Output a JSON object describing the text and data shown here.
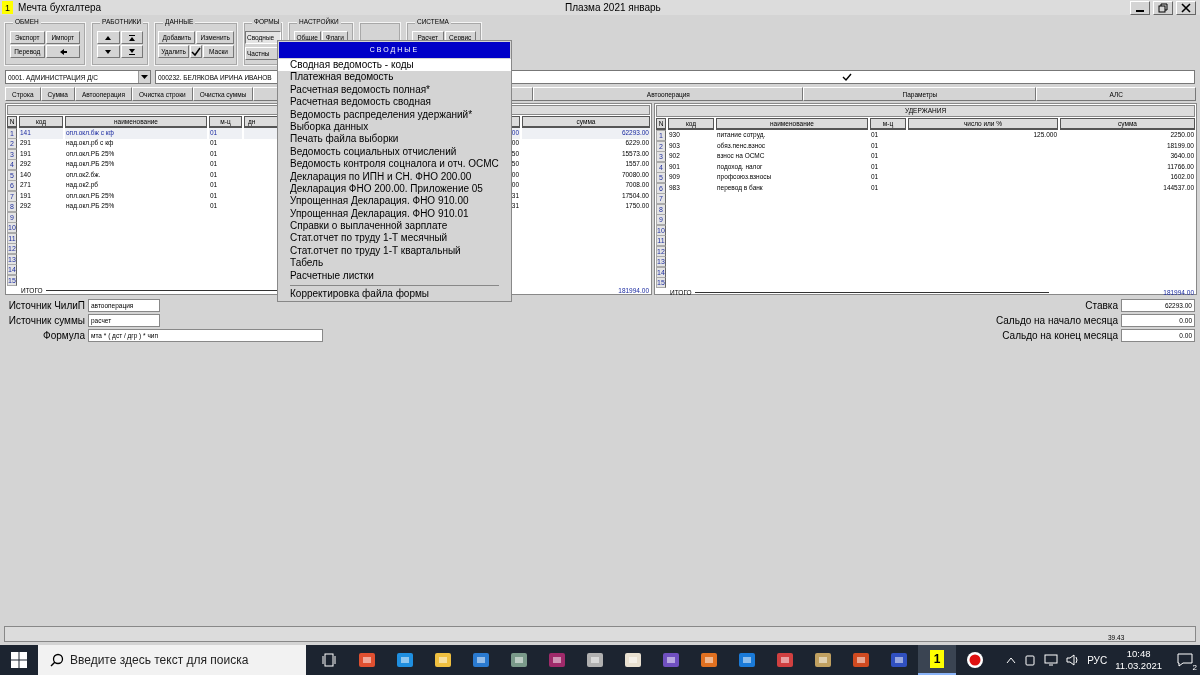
{
  "window": {
    "app_badge": "1",
    "title": "Мечта бухгалтера",
    "center_title": "Плазма 2021 январь"
  },
  "toolbar": {
    "groups": [
      {
        "title": "ОБМЕН",
        "kind": "text",
        "buttons": [
          {
            "label": "Экспорт"
          },
          {
            "label": "Импорт"
          },
          {
            "label": "Перевод"
          },
          {
            "kind": "icon"
          }
        ]
      },
      {
        "title": "РАБОТНИКИ",
        "kind": "icons",
        "buttons": [
          {
            "kind": "icon"
          },
          {
            "kind": "icon"
          },
          {
            "kind": "icon"
          },
          {
            "kind": "icon"
          }
        ]
      },
      {
        "title": "ДАННЫЕ",
        "kind": "text",
        "buttons": [
          {
            "label": "Добавить"
          },
          {
            "label": "Изменить"
          },
          {
            "label": "Удалить"
          },
          {
            "kind": "icon"
          },
          {
            "label": "Маски"
          }
        ]
      },
      {
        "title": "ФОРМЫ",
        "kind": "text",
        "buttons": [
          {
            "label": "Сводные",
            "pressed": true
          },
          {
            "label": "Частны",
            "pressed": false
          }
        ]
      },
      {
        "title": "НАСТРОЙКИ",
        "kind": "text",
        "buttons": [
          {
            "label": "Общие"
          },
          {
            "label": "Флаги"
          }
        ]
      },
      {
        "kind": "empty"
      },
      {
        "title": "СИСТЕМА",
        "kind": "text",
        "buttons": [
          {
            "label": "Расчет"
          },
          {
            "label": "Сервис"
          }
        ]
      }
    ]
  },
  "selectors": {
    "department": "0001. АДМИНИСТРАЦИЯ Д/С",
    "employee": "000232. БЕЛЯКОВА ИРИНА ИВАНОВ",
    "confirmed": true
  },
  "action_buttons": [
    "Строка",
    "Сумма",
    "Автооперация",
    "Очистка строки",
    "Очистка суммы"
  ],
  "right_buttons": [
    "Автооперация",
    "Параметры",
    "АЛС"
  ],
  "accruals": {
    "columns": [
      "N",
      "код",
      "наименование",
      "м-ц",
      "дн",
      "сумма"
    ],
    "rows": [
      {
        "n": "1",
        "code": "141",
        "name": "опл.окл.бж с кф",
        "month": "01",
        "column_5": "00",
        "sum": "62293.00",
        "selected": true
      },
      {
        "n": "2",
        "code": "291",
        "name": "над.окл.рб с кф",
        "month": "01",
        "column_5": "00",
        "sum": "6229.00",
        "selected": false
      },
      {
        "n": "3",
        "code": "191",
        "name": "опл.окл.РБ 25%",
        "month": "01",
        "column_5": "50",
        "sum": "15573.00",
        "selected": false
      },
      {
        "n": "4",
        "code": "292",
        "name": "над.окл.РБ 25%",
        "month": "01",
        "column_5": "50",
        "sum": "1557.00",
        "selected": false
      },
      {
        "n": "5",
        "code": "140",
        "name": "опл.ок2.бж.",
        "month": "01",
        "column_5": "00",
        "sum": "70080.00",
        "selected": false
      },
      {
        "n": "6",
        "code": "271",
        "name": "над.ок2.рб",
        "month": "01",
        "column_5": "00",
        "sum": "7008.00",
        "selected": false
      },
      {
        "n": "7",
        "code": "191",
        "name": "опл.окл.РБ 25%",
        "month": "01",
        "column_5": "31",
        "sum": "17504.00",
        "selected": false
      },
      {
        "n": "8",
        "code": "292",
        "name": "над.окл.РБ 25%",
        "month": "01",
        "column_5": "31",
        "sum": "1750.00",
        "selected": false
      },
      {
        "n": "9"
      },
      {
        "n": "10"
      },
      {
        "n": "11"
      },
      {
        "n": "12"
      },
      {
        "n": "13"
      },
      {
        "n": "14"
      },
      {
        "n": "15"
      }
    ],
    "total_label": "ИТОГО",
    "total": "181994.00"
  },
  "deductions": {
    "title": "УДЕРЖАНИЯ",
    "columns": [
      "N",
      "код",
      "наименование",
      "м-ц",
      "число или %",
      "сумма"
    ],
    "rows": [
      {
        "n": "1",
        "code": "930",
        "name": "питание сотруд.",
        "month": "01",
        "value": "125.000",
        "sum": "2250.00"
      },
      {
        "n": "2",
        "code": "903",
        "name": "обяз.пенс.взнос",
        "month": "01",
        "sum": "18199.00"
      },
      {
        "n": "3",
        "code": "902",
        "name": "взнос на ОСМС",
        "month": "01",
        "sum": "3640.00"
      },
      {
        "n": "4",
        "code": "901",
        "name": "подоход. налог",
        "month": "01",
        "sum": "11766.00"
      },
      {
        "n": "5",
        "code": "909",
        "name": "профсоюз.взносы",
        "month": "01",
        "sum": "1602.00"
      },
      {
        "n": "6",
        "code": "983",
        "name": "перевод в банк",
        "month": "01",
        "sum": "144537.00"
      },
      {
        "n": "7"
      },
      {
        "n": "8"
      },
      {
        "n": "9"
      },
      {
        "n": "10"
      },
      {
        "n": "11"
      },
      {
        "n": "12"
      },
      {
        "n": "13"
      },
      {
        "n": "14"
      },
      {
        "n": "15"
      }
    ],
    "total_label": "ИТОГО",
    "total": "181994.00"
  },
  "left_fields": [
    {
      "label": "Источник ЧилиП",
      "value": "автооперация"
    },
    {
      "label": "Источник суммы",
      "value": "расчет"
    },
    {
      "label": "Формула",
      "value": "мта * ( дст / дгр ) * чип"
    }
  ],
  "right_fields": [
    {
      "label": "Ставка",
      "value": "62293.00"
    },
    {
      "label": "Сальдо на начало месяца",
      "value": "0.00"
    },
    {
      "label": "Сальдо на конец месяца",
      "value": "0.00"
    }
  ],
  "status_bar": {
    "value": "39.43"
  },
  "menu": {
    "title": "СВОДНЫЕ",
    "items": [
      {
        "label": "Сводная ведомость - коды",
        "selected": true
      },
      {
        "label": "Платежная ведомость",
        "selected": false
      },
      {
        "label": "Расчетная ведомость полная*",
        "selected": false
      },
      {
        "label": "Расчетная ведомость сводная",
        "selected": false
      },
      {
        "label": "Ведомость распределения удержаний*",
        "selected": false
      },
      {
        "label": "Выборка данных",
        "selected": false
      },
      {
        "label": "Печать файла выборки",
        "selected": false
      },
      {
        "label": "Ведомость социальных отчислений",
        "selected": false
      },
      {
        "label": "Ведомость контроля соцналога и отч. ОСМС",
        "selected": false
      },
      {
        "label": "Декларация по ИПН и СН. ФНО 200.00",
        "selected": false
      },
      {
        "label": "Декларация ФНО 200.00. Приложение 05",
        "selected": false
      },
      {
        "label": "Упрощенная Декларация. ФНО 910.00",
        "selected": false
      },
      {
        "label": "Упрощенная Декларация. ФНО 910.01",
        "selected": false
      },
      {
        "label": "Справки о выплаченной зарплате",
        "selected": false
      },
      {
        "label": "Стат.отчет по труду 1-Т месячный",
        "selected": false
      },
      {
        "label": "Стат.отчет по труду 1-Т квартальный",
        "selected": false
      },
      {
        "label": "Табель",
        "selected": false
      },
      {
        "label": "Расчетные листки",
        "selected": false
      }
    ],
    "footer_items": [
      {
        "label": "Корректировка файла формы",
        "selected": false
      }
    ]
  },
  "taskbar": {
    "search_placeholder": "Введите здесь текст для поиска",
    "app_badge": "1",
    "app_active": true,
    "language": "РУС",
    "time": "10:48",
    "date": "11.03.2021",
    "notifications": "2"
  }
}
